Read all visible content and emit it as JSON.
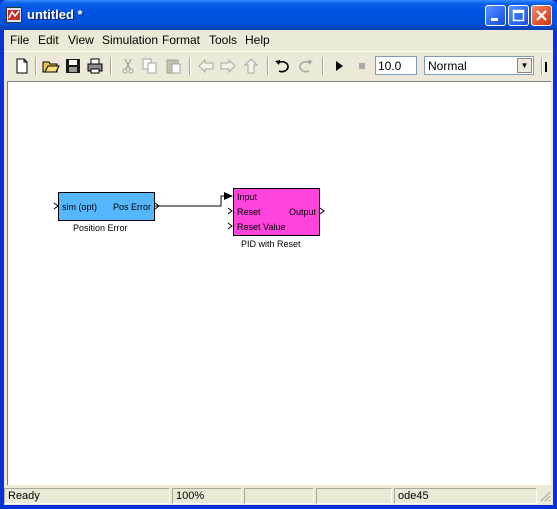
{
  "window": {
    "title": "untitled *"
  },
  "menu": [
    "File",
    "Edit",
    "View",
    "Simulation",
    "Format",
    "Tools",
    "Help"
  ],
  "toolbar": {
    "stop_time": "10.0",
    "sim_mode": "Normal"
  },
  "blocks": {
    "position_error": {
      "in_port": "sim (opt)",
      "out_port": "Pos Error",
      "label": "Position Error",
      "color": "#55b8ff"
    },
    "pid": {
      "in_ports": [
        "Input",
        "Reset",
        "Reset Value"
      ],
      "out_port": "Output",
      "label": "PID with Reset",
      "color": "#ff44dd"
    }
  },
  "status": {
    "state": "Ready",
    "zoom": "100%",
    "solver": "ode45"
  }
}
